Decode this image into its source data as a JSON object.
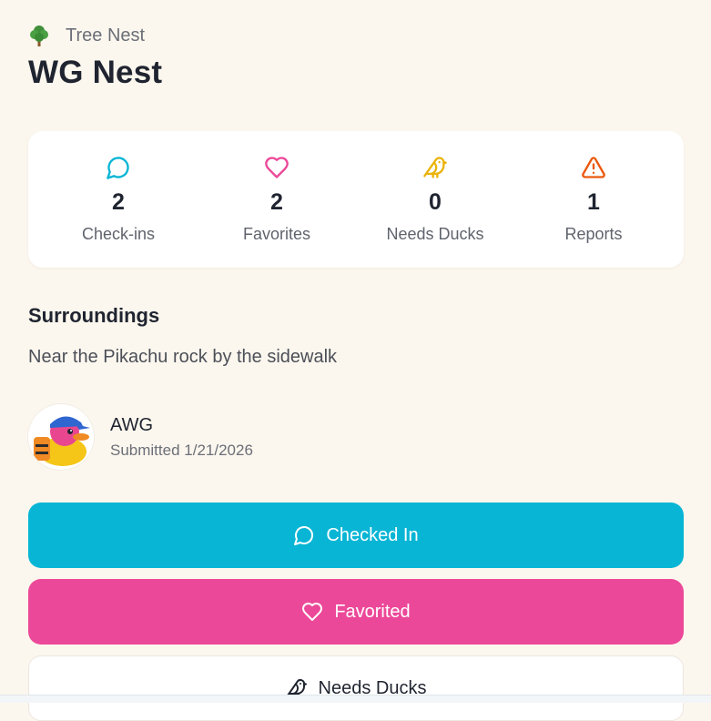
{
  "header": {
    "type_label": "Tree Nest",
    "title": "WG Nest"
  },
  "stats": [
    {
      "icon": "chat-bubble-icon",
      "color": "#08b5d5",
      "value": "2",
      "label": "Check-ins"
    },
    {
      "icon": "heart-icon",
      "color": "#ec4899",
      "value": "2",
      "label": "Favorites"
    },
    {
      "icon": "bird-icon",
      "color": "#eab308",
      "value": "0",
      "label": "Needs Ducks"
    },
    {
      "icon": "warning-icon",
      "color": "#ea580c",
      "value": "1",
      "label": "Reports"
    }
  ],
  "surroundings": {
    "title": "Surroundings",
    "text": "Near the Pikachu rock by the sidewalk"
  },
  "submitter": {
    "name": "AWG",
    "submitted": "Submitted 1/21/2026"
  },
  "actions": {
    "checkin_label": "Checked In",
    "favorite_label": "Favorited",
    "needs_ducks_label": "Needs Ducks"
  },
  "colors": {
    "background": "#fcf7ee",
    "checkin": "#08b5d5",
    "favorite": "#ec4899"
  }
}
